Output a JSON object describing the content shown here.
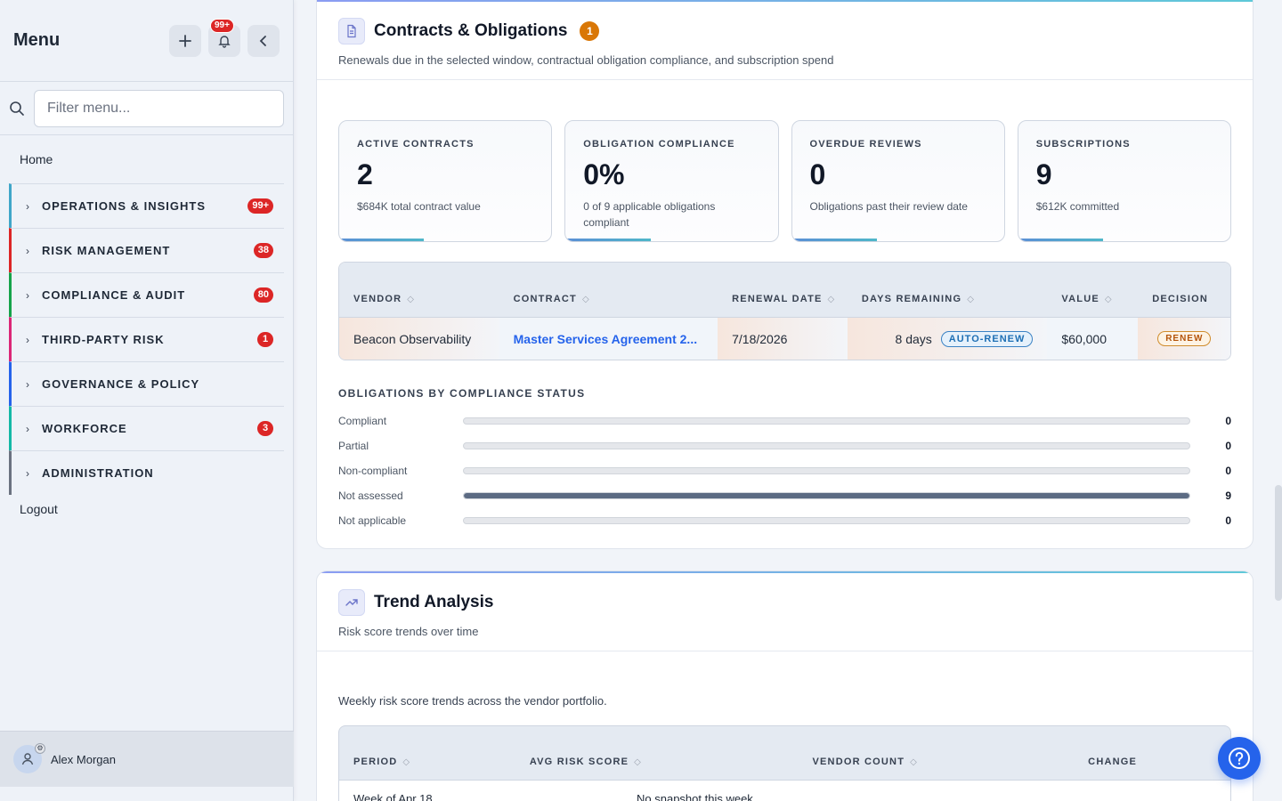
{
  "sidebar": {
    "title": "Menu",
    "notification_badge": "99+",
    "filter_placeholder": "Filter menu...",
    "home": "Home",
    "sections": [
      {
        "label": "OPERATIONS & INSIGHTS",
        "count": "99+",
        "color": "#3fa6c9"
      },
      {
        "label": "RISK MANAGEMENT",
        "count": "38",
        "color": "#dc2626"
      },
      {
        "label": "COMPLIANCE & AUDIT",
        "count": "80",
        "color": "#16a34a"
      },
      {
        "label": "THIRD-PARTY RISK",
        "count": "1",
        "color": "#db2777"
      },
      {
        "label": "GOVERNANCE & POLICY",
        "count": "",
        "color": "#2563eb"
      },
      {
        "label": "WORKFORCE",
        "count": "3",
        "color": "#14b8a6"
      },
      {
        "label": "ADMINISTRATION",
        "count": "",
        "color": "#6b7280"
      }
    ],
    "logout": "Logout",
    "user_name": "Alex Morgan"
  },
  "contracts": {
    "title": "Contracts & Obligations",
    "count": "1",
    "subtitle": "Renewals due in the selected window, contractual obligation compliance, and subscription spend",
    "stats": [
      {
        "label": "ACTIVE CONTRACTS",
        "value": "2",
        "sub": "$684K total contract value"
      },
      {
        "label": "OBLIGATION COMPLIANCE",
        "value": "0%",
        "sub": "0 of 9 applicable obligations compliant"
      },
      {
        "label": "OVERDUE REVIEWS",
        "value": "0",
        "sub": "Obligations past their review date"
      },
      {
        "label": "SUBSCRIPTIONS",
        "value": "9",
        "sub": "$612K committed"
      }
    ],
    "table": {
      "headers": [
        "VENDOR",
        "CONTRACT",
        "RENEWAL DATE",
        "DAYS REMAINING",
        "VALUE",
        "DECISION"
      ],
      "row": {
        "vendor": "Beacon Observability",
        "contract": "Master Services Agreement 2...",
        "renewal_date": "7/18/2026",
        "days": "8 days",
        "days_tag": "AUTO-RENEW",
        "value": "$60,000",
        "decision": "RENEW"
      }
    },
    "obligations_title": "OBLIGATIONS BY COMPLIANCE STATUS",
    "obligations": [
      {
        "label": "Compliant",
        "count": 0
      },
      {
        "label": "Partial",
        "count": 0
      },
      {
        "label": "Non-compliant",
        "count": 0
      },
      {
        "label": "Not assessed",
        "count": 9
      },
      {
        "label": "Not applicable",
        "count": 0
      }
    ],
    "obligations_total": 9
  },
  "trend": {
    "title": "Trend Analysis",
    "subtitle": "Risk score trends over time",
    "description": "Weekly risk score trends across the vendor portfolio.",
    "headers": [
      "PERIOD",
      "AVG RISK SCORE",
      "VENDOR COUNT",
      "CHANGE"
    ],
    "first_row": {
      "period": "Week of Apr 18",
      "note": "No snapshot this week"
    }
  }
}
